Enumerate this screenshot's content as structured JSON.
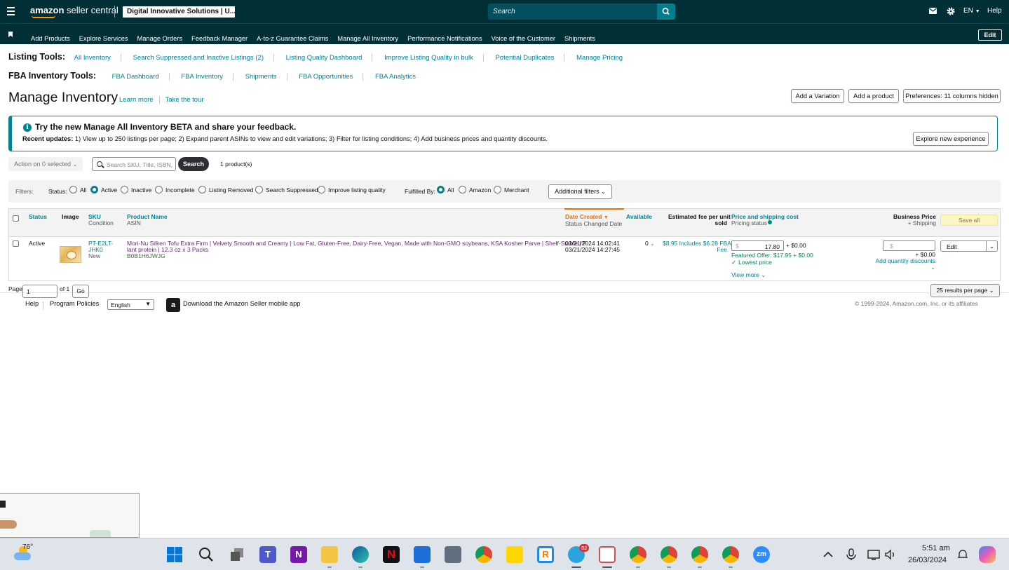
{
  "topbar": {
    "logo_brand": "amazon",
    "logo_rest": " seller central",
    "account": "Digital Innovative Solutions | U...",
    "search_placeholder": "Search",
    "lang": "EN",
    "help": "Help",
    "icons": [
      "menu-icon",
      "mail-icon",
      "gear-icon",
      "search-icon"
    ]
  },
  "nav": {
    "items": [
      "Add Products",
      "Explore Services",
      "Manage Orders",
      "Feedback Manager",
      "A-to-z Guarantee Claims",
      "Manage All Inventory",
      "Performance Notifications",
      "Voice of the Customer",
      "Shipments"
    ],
    "edit": "Edit"
  },
  "listing_tools": {
    "title": "Listing Tools:",
    "links": [
      "All Inventory",
      "Search Suppressed and Inactive Listings (2)",
      "Listing Quality Dashboard",
      "Improve Listing Quality in bulk",
      "Potential Duplicates",
      "Manage Pricing"
    ]
  },
  "fba_tools": {
    "title": "FBA Inventory Tools:",
    "links": [
      "FBA Dashboard",
      "FBA Inventory",
      "Shipments",
      "FBA Opportunities",
      "FBA Analytics"
    ]
  },
  "page": {
    "title": "Manage Inventory",
    "learn_more": "Learn more",
    "tour": "Take the tour",
    "add_variation": "Add a Variation",
    "add_product": "Add a product",
    "preferences": "Preferences: 11 columns hidden"
  },
  "banner": {
    "heading": "Try the new Manage All Inventory BETA and share your feedback.",
    "sub_label": "Recent updates:",
    "sub_text": " 1) View up to 250 listings per page; 2) Expand parent ASINs to view and edit variations; 3) Filter for listing conditions; 4) Add business prices and quantity discounts.",
    "explore": "Explore new experience"
  },
  "actions": {
    "action_dd": "Action on 0 selected",
    "search_placeholder": "Search SKU, Title, ISBN,",
    "search_btn": "Search",
    "count": "1 product(s)"
  },
  "filters": {
    "label": "Filters:",
    "status_label": "Status:",
    "status_options": [
      {
        "label": "All",
        "selected": false
      },
      {
        "label": "Active",
        "selected": true
      },
      {
        "label": "Inactive",
        "selected": false
      },
      {
        "label": "Incomplete",
        "selected": false
      },
      {
        "label": "Listing Removed",
        "selected": false
      },
      {
        "label": "Search Suppressed",
        "selected": false
      },
      {
        "label": "Improve listing quality",
        "selected": false
      }
    ],
    "fulfilled_label": "Fulfilled By:",
    "fulfilled_options": [
      {
        "label": "All",
        "selected": true
      },
      {
        "label": "Amazon",
        "selected": false
      },
      {
        "label": "Merchant",
        "selected": false
      }
    ],
    "additional": "Additional filters"
  },
  "table": {
    "headers": {
      "status": "Status",
      "image": "Image",
      "sku": "SKU",
      "condition": "Condition",
      "product_name": "Product Name",
      "asin": "ASIN",
      "date_created": "Date Created",
      "status_changed": "Status Changed Date",
      "available": "Available",
      "fee_1": "Estimated fee per unit",
      "fee_2": "sold",
      "price": "Price and shipping cost",
      "pricing_status": "Pricing status",
      "business_price": "Business Price",
      "shipping": "+ Shipping",
      "save_all": "Save all"
    },
    "row": {
      "status": "Active",
      "sku_1": "PT-E2LT-",
      "sku_2": "JHK0",
      "condition": "New",
      "name_1": "Mori-Nu Silken Tofu Extra Firm | Velvety Smooth and Creamy | Low Fat, Gluten-Free, Dairy-Free, Vegan, Made with Non-GMO soybeans, KSA Kosher Parve | Shelf-Stable | P",
      "name_2": "lant protein | 12.3 oz x 3 Packs",
      "asin": "B0B1H6JWJG",
      "date_created": "03/21/2024 14:02:41",
      "status_changed": "03/21/2024 14:27:45",
      "available": "0",
      "fee_1": "$8.95 Includes $6.28 FBA",
      "fee_2": "Fee",
      "price_currency": "$",
      "price": "17.80",
      "price_ship": "+ $0.00",
      "featured": "Featured Offer: $17.95 + $0.00",
      "lowest": "Lowest price",
      "view_more": "View more",
      "biz_currency": "$",
      "biz_ship": "+ $0.00",
      "qty_discounts": "Add quantity discounts",
      "edit": "Edit"
    }
  },
  "pager": {
    "page_label": "Page",
    "page_value": "1",
    "of": "of 1",
    "go": "Go",
    "per_page": "25 results per page"
  },
  "footer": {
    "help": "Help",
    "policies": "Program Policies",
    "language": "English",
    "app": "Download the Amazon Seller mobile app",
    "copyright": "© 1999-2024, Amazon.com, Inc. or its affiliates"
  },
  "taskbar": {
    "temp": "76°",
    "time": "5:51 am",
    "date": "26/03/2024",
    "badge": "82"
  }
}
